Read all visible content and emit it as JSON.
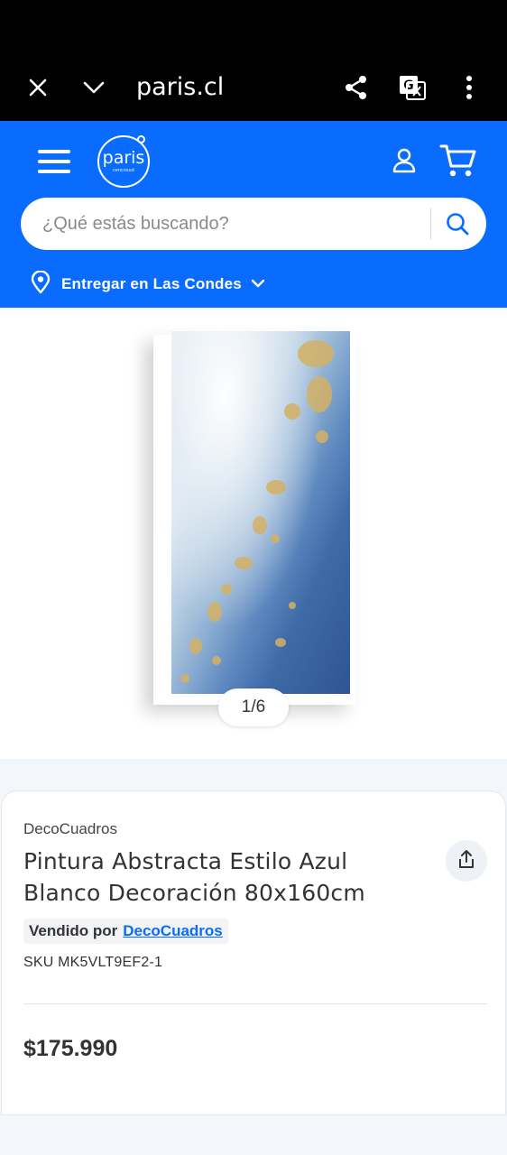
{
  "browser": {
    "url": "paris.cl",
    "icons": [
      "close-icon",
      "chevron-down-icon",
      "share-icon",
      "translate-icon",
      "more-vertical-icon"
    ]
  },
  "header": {
    "logo_text": "paris",
    "logo_subtext": "cencosud",
    "search": {
      "placeholder": "¿Qué estás buscando?"
    },
    "delivery_text": "Entregar en Las Condes",
    "colors": {
      "brand_blue": "#0a6cff"
    }
  },
  "gallery": {
    "counter": "1/6"
  },
  "product": {
    "brand": "DecoCuadros",
    "title": "Pintura Abstracta Estilo Azul Blanco Decoración 80x160cm",
    "seller_label": "Vendido por",
    "seller_name": "DecoCuadros",
    "sku": "SKU MK5VLT9EF2-1",
    "price": "$175.990"
  }
}
